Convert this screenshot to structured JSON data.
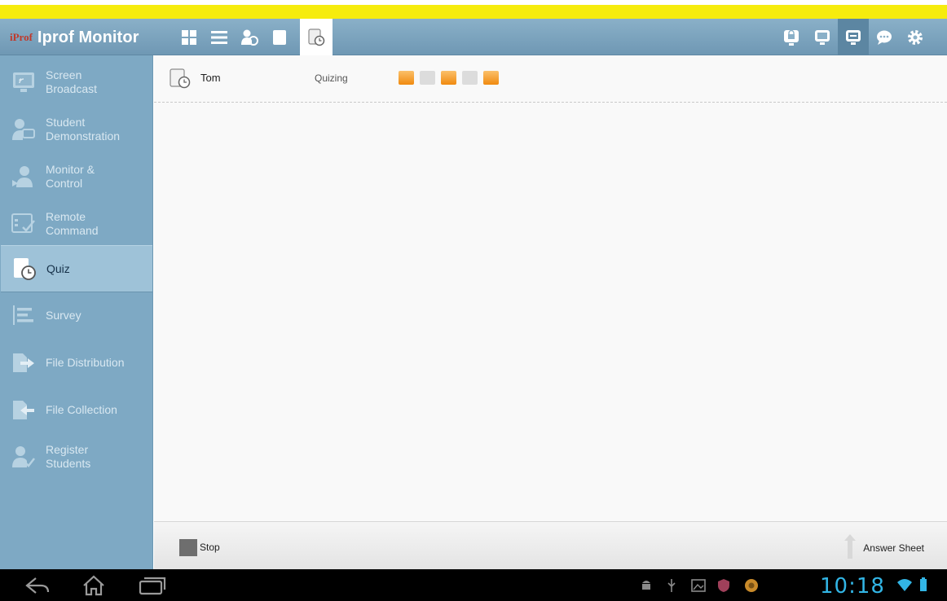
{
  "app": {
    "logo_text": "iProf",
    "title": "Iprof Monitor"
  },
  "toolbar": {
    "icons": [
      "grid-view-icon",
      "list-view-icon",
      "students-icon",
      "blank-page-icon",
      "quiz-icon"
    ],
    "active": "quiz-icon",
    "right_icons": [
      "screen-lock-icon",
      "monitor-icon",
      "monitor-active-icon",
      "chat-icon",
      "settings-icon"
    ]
  },
  "sidebar": {
    "items": [
      {
        "label": "Screen\nBroadcast",
        "icon": "screen-broadcast-icon"
      },
      {
        "label": "Student\nDemonstration",
        "icon": "student-demonstration-icon"
      },
      {
        "label": "Monitor &\nControl",
        "icon": "monitor-control-icon"
      },
      {
        "label": "Remote\nCommand",
        "icon": "remote-command-icon"
      },
      {
        "label": "Quiz",
        "icon": "quiz-icon",
        "active": true
      },
      {
        "label": "Survey",
        "icon": "survey-icon"
      },
      {
        "label": "File Distribution",
        "icon": "file-distribution-icon"
      },
      {
        "label": "File Collection",
        "icon": "file-collection-icon"
      },
      {
        "label": "Register\nStudents",
        "icon": "register-students-icon"
      }
    ]
  },
  "quiz_list": {
    "rows": [
      {
        "name": "Tom",
        "status": "Quizing",
        "progress": [
          "answered",
          "unanswered",
          "answered",
          "unanswered",
          "answered"
        ]
      }
    ]
  },
  "bottom": {
    "stop_label": "Stop",
    "answer_sheet_label": "Answer Sheet"
  },
  "system": {
    "time": "10:18"
  },
  "colors": {
    "yellow_bar": "#f6ec0d",
    "header": "#7aa3be",
    "sidebar": "#7ea9c4",
    "answered": "#f39a1e",
    "unanswered": "#dcdcdc",
    "clock": "#32b5e5"
  }
}
